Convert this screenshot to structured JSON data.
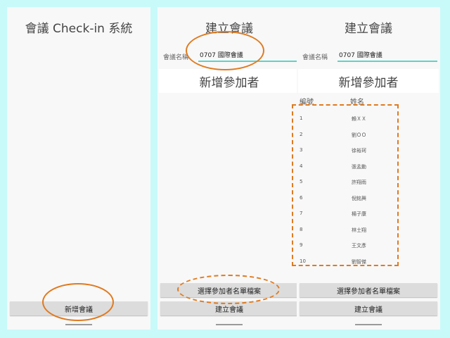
{
  "screens": {
    "main": {
      "title": "會議 Check-in 系統",
      "new_meeting_button": "新增會議"
    },
    "create": {
      "title": "建立會議",
      "meeting_name_label": "會議名稱",
      "meeting_name_value": "0707 國際會議",
      "add_participant_label": "新增參加者",
      "pick_file_button": "選擇參加者名單檔案",
      "create_button": "建立會議"
    },
    "create_filled": {
      "title": "建立會議",
      "meeting_name_label": "會議名稱",
      "meeting_name_value": "0707 國際會議",
      "add_participant_label": "新增參加者",
      "col_no": "編號",
      "col_name": "姓名",
      "participants": [
        {
          "no": "1",
          "name": "賴ＸＸ"
        },
        {
          "no": "2",
          "name": "劉ＯＯ"
        },
        {
          "no": "3",
          "name": "徐裕珂"
        },
        {
          "no": "4",
          "name": "張孟勳"
        },
        {
          "no": "5",
          "name": "許翔雨"
        },
        {
          "no": "6",
          "name": "倪銘興"
        },
        {
          "no": "7",
          "name": "楊子康"
        },
        {
          "no": "8",
          "name": "林士翔"
        },
        {
          "no": "9",
          "name": "王文彥"
        },
        {
          "no": "10",
          "name": "劉智傑"
        }
      ],
      "pick_file_button": "選擇參加者名單檔案",
      "create_button": "建立會議"
    }
  },
  "annotation_color": "#e07a1f"
}
